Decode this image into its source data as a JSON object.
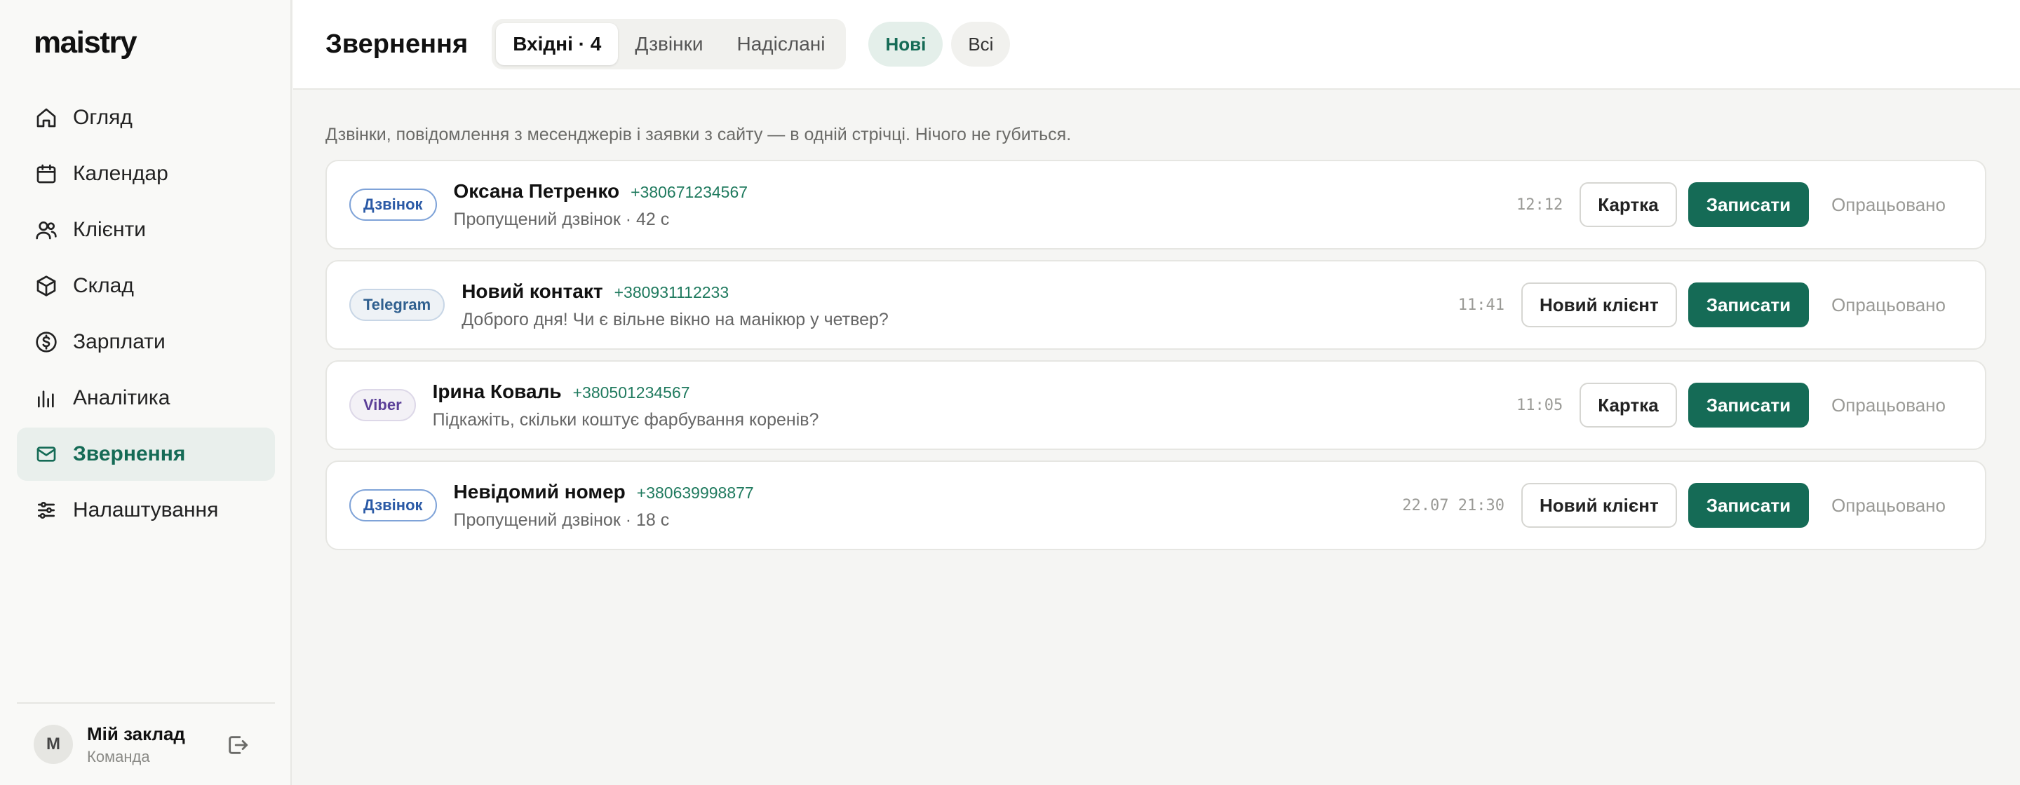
{
  "app": {
    "logo": "maistry"
  },
  "sidebar": {
    "items": [
      {
        "label": "Огляд",
        "icon": "home-icon"
      },
      {
        "label": "Календар",
        "icon": "calendar-icon"
      },
      {
        "label": "Клієнти",
        "icon": "users-icon"
      },
      {
        "label": "Склад",
        "icon": "box-icon"
      },
      {
        "label": "Зарплати",
        "icon": "dollar-icon"
      },
      {
        "label": "Аналітика",
        "icon": "bar-chart-icon"
      },
      {
        "label": "Звернення",
        "icon": "mail-icon"
      },
      {
        "label": "Налаштування",
        "icon": "sliders-icon"
      }
    ],
    "account": {
      "initial": "М",
      "name": "Мій заклад",
      "role": "Команда"
    }
  },
  "header": {
    "title": "Звернення",
    "tabs": [
      {
        "label": "Вхідні · 4"
      },
      {
        "label": "Дзвінки"
      },
      {
        "label": "Надіслані"
      }
    ],
    "filters": [
      {
        "label": "Нові"
      },
      {
        "label": "Всі"
      }
    ]
  },
  "main": {
    "subtitle": "Дзвінки, повідомлення з месенджерів і заявки з сайту — в одній стрічці. Нічого не губиться.",
    "rows": [
      {
        "source": "Дзвінок",
        "name": "Оксана Петренко",
        "phone": "+380671234567",
        "message": "Пропущений дзвінок · 42 с",
        "time": "12:12",
        "secondary": "Картка",
        "primary": "Записати",
        "done": "Опрацьовано"
      },
      {
        "source": "Telegram",
        "name": "Новий контакт",
        "phone": "+380931112233",
        "message": "Доброго дня! Чи є вільне вікно на манікюр у четвер?",
        "time": "11:41",
        "secondary": "Новий клієнт",
        "primary": "Записати",
        "done": "Опрацьовано"
      },
      {
        "source": "Viber",
        "name": "Ірина Коваль",
        "phone": "+380501234567",
        "message": "Підкажіть, скільки коштує фарбування коренів?",
        "time": "11:05",
        "secondary": "Картка",
        "primary": "Записати",
        "done": "Опрацьовано"
      },
      {
        "source": "Дзвінок",
        "name": "Невідомий номер",
        "phone": "+380639998877",
        "message": "Пропущений дзвінок · 18 с",
        "time": "22.07 21:30",
        "secondary": "Новий клієнт",
        "primary": "Записати",
        "done": "Опрацьовано"
      }
    ]
  },
  "colors": {
    "accent": "#156b56",
    "accent_soft": "#e9efec",
    "call_badge": "#2b5aa6",
    "viber_badge": "#5b3f98"
  }
}
